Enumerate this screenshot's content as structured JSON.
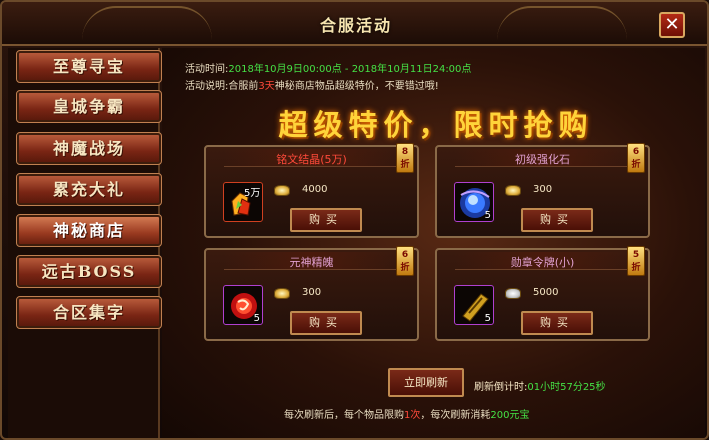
{
  "window": {
    "title": "合服活动",
    "close_label": "✕"
  },
  "sidebar": {
    "items": [
      {
        "label": "至尊寻宝"
      },
      {
        "label": "皇城争霸"
      },
      {
        "label": "神魔战场"
      },
      {
        "label": "累充大礼"
      },
      {
        "label": "神秘商店",
        "active": true
      },
      {
        "label": "远古BOSS"
      },
      {
        "label": "合区集字"
      }
    ]
  },
  "info": {
    "time_label": "活动时间:",
    "time_value": "2018年10月9日00:00点 - 2018年10月11日24:00点",
    "desc_label": "活动说明:",
    "desc_pre": "合服前",
    "desc_days": "3天",
    "desc_post": "神秘商店物品超级特价，不要错过哦!"
  },
  "banner": "超级特价，限时抢购",
  "shop": {
    "items": [
      {
        "name": "铭文结晶(5万)",
        "discount_num": "8",
        "discount_unit": "折",
        "qty_label": "5万",
        "price": "4000",
        "buy_label": "购买",
        "icon": "inscription-crystal-icon",
        "color": "#ff4a3a"
      },
      {
        "name": "初级强化石",
        "discount_num": "6",
        "discount_unit": "折",
        "qty": "5",
        "price": "300",
        "buy_label": "购买",
        "icon": "enhancement-stone-icon",
        "color": "#e0a0d0"
      },
      {
        "name": "元神精魄",
        "discount_num": "6",
        "discount_unit": "折",
        "qty": "5",
        "price": "300",
        "buy_label": "购买",
        "icon": "soul-essence-icon",
        "color": "#e0a0d0"
      },
      {
        "name": "勋章令牌(小)",
        "discount_num": "5",
        "discount_unit": "折",
        "qty": "5",
        "price": "5000",
        "buy_label": "购买",
        "icon": "medal-token-icon",
        "color": "#e0a0d0"
      }
    ]
  },
  "refresh": {
    "button_label": "立即刷新",
    "countdown_label": "刷新倒计时:",
    "countdown_value": "01小时57分25秒"
  },
  "footnote": {
    "pre": "每次刷新后，每个物品限购",
    "limit": "1次",
    "mid": "，每次刷新消耗",
    "cost": "200元宝"
  },
  "colors": {
    "accent_gold": "#ffd43a",
    "countdown_green": "#45e045",
    "highlight_red": "#ff4a3a"
  }
}
